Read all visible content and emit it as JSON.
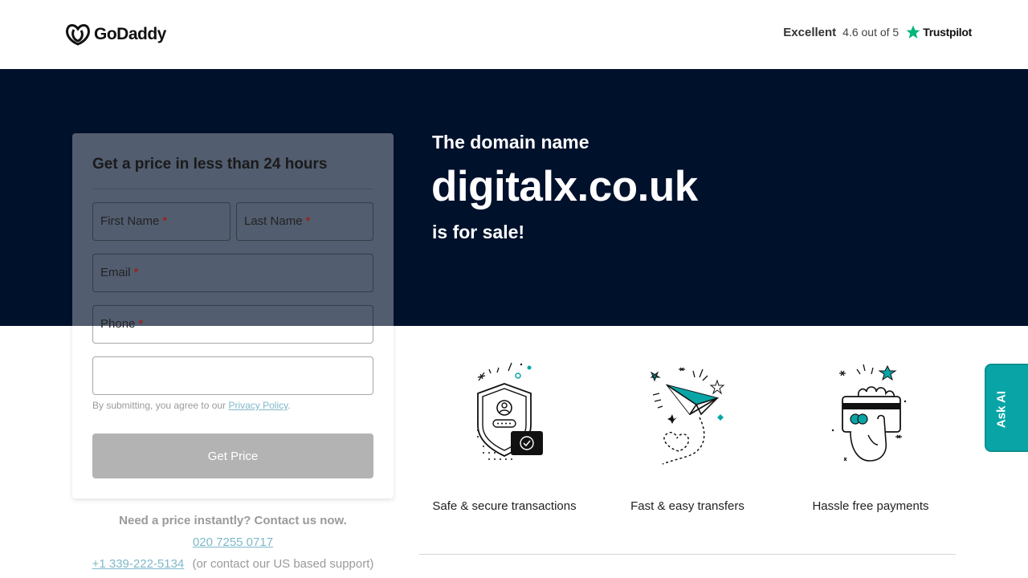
{
  "header": {
    "logo_text": "GoDaddy",
    "trust": {
      "word": "Excellent",
      "score": "4.6 out of 5",
      "brand": "Trustpilot"
    }
  },
  "hero": {
    "line1": "The domain name",
    "domain": "digitalx.co.uk",
    "line2": "is for sale!"
  },
  "form": {
    "title": "Get a price in less than 24 hours",
    "first_name": "First Name",
    "last_name": "Last Name",
    "email": "Email",
    "phone": "Phone",
    "required_mark": "*",
    "privacy_prefix": "By submitting, you agree to our",
    "privacy_link": "Privacy Policy",
    "privacy_suffix": ".",
    "submit_label": "Get Price"
  },
  "contact": {
    "prompt": "Need a price instantly? Contact us now.",
    "phone_uk": "020 7255 0717",
    "phone_us": "+1 339-222-5134",
    "us_note": "(or contact our US based support)"
  },
  "features": [
    {
      "label": "Safe & secure transactions",
      "icon": "shield-icon"
    },
    {
      "label": "Fast & easy transfers",
      "icon": "paper-plane-icon"
    },
    {
      "label": "Hassle free payments",
      "icon": "card-hand-icon"
    }
  ],
  "ask_ai": {
    "label": "Ask AI"
  },
  "colors": {
    "hero_bg": "#00112c",
    "accent": "#09a5a6",
    "button_disabled": "#b3b3b3",
    "link": "#7fb9c9"
  }
}
